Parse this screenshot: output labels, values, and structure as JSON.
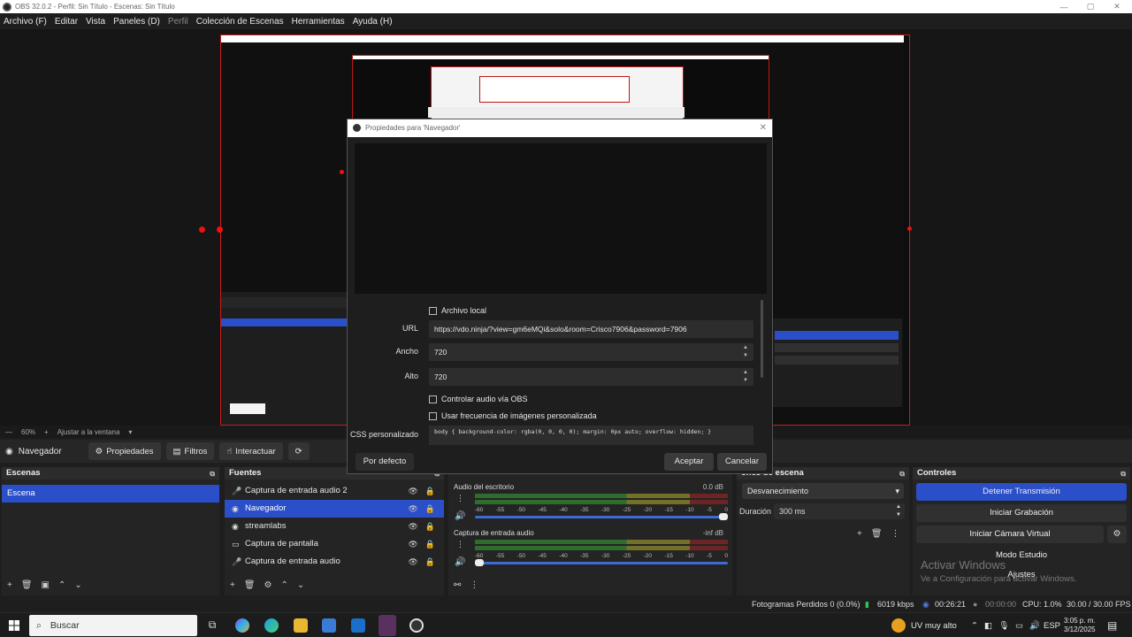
{
  "window": {
    "title": "OBS 32.0.2 - Perfil: Sin Título - Escenas: Sin Título"
  },
  "menu": [
    "Archivo (F)",
    "Editar",
    "Vista",
    "Paneles (D)",
    "Perfil",
    "Colección de Escenas",
    "Herramientas",
    "Ayuda (H)"
  ],
  "zoom": {
    "value": "60%",
    "fit": "Ajustar a la ventana"
  },
  "source_toolbar": {
    "source": "Navegador",
    "properties": "Propiedades",
    "filters": "Filtros",
    "interact": "Interactuar"
  },
  "scenes": {
    "title": "Escenas",
    "items": [
      "Escena"
    ]
  },
  "sources": {
    "title": "Fuentes",
    "items": [
      "Captura de entrada audio 2",
      "Navegador",
      "streamlabs",
      "Captura de pantalla",
      "Captura de entrada audio"
    ]
  },
  "mixer": {
    "tracks": [
      {
        "name": "Audio del escritorio",
        "db": "0.0 dB"
      },
      {
        "name": "Captura de entrada audio",
        "db": "-inf dB"
      }
    ],
    "ticks": [
      "-60",
      "-55",
      "-50",
      "-45",
      "-40",
      "-35",
      "-30",
      "-25",
      "-20",
      "-15",
      "-10",
      "-5",
      "0"
    ]
  },
  "transitions": {
    "title": "ones de escena",
    "type": "Desvanecimiento",
    "duration_label": "Duración",
    "duration_value": "300 ms"
  },
  "controls": {
    "title": "Controles",
    "stop_stream": "Detener Transmisión",
    "start_record": "Iniciar Grabación",
    "virtual_cam": "Iniciar Cámara Virtual",
    "studio": "Modo Estudio",
    "settings": "Ajustes"
  },
  "status": {
    "dropped": "Fotogramas Perdidos 0 (0.0%)",
    "kbps": "6019 kbps",
    "live_time": "00:26:21",
    "rec_time": "00:00:00",
    "cpu": "CPU: 1.0%",
    "fps": "30.00 / 30.00 FPS"
  },
  "activate": {
    "title": "Activar Windows",
    "sub": "Ve a Configuración para activar Windows."
  },
  "dialog": {
    "title": "Propiedades para 'Navegador'",
    "local_file": "Archivo local",
    "url_label": "URL",
    "url_value": "https://vdo.ninja/?view=gm6eMQi&solo&room=Crisco7906&password=7906",
    "width_label": "Ancho",
    "width_value": "720",
    "height_label": "Alto",
    "height_value": "720",
    "audio_obs": "Controlar audio vía OBS",
    "custom_fps": "Usar frecuencia de imágenes personalizada",
    "css_label": "CSS personalizado",
    "css_value": "body { background-color: rgba(0, 0, 0, 0); margin: 0px auto; overflow: hidden; }",
    "defaults": "Por defecto",
    "ok": "Aceptar",
    "cancel": "Cancelar"
  },
  "taskbar": {
    "search": "Buscar",
    "weather": "UV muy alto",
    "lang": "ESP",
    "time": "3:05 p. m.",
    "date": "3/12/2025"
  },
  "colors": {
    "accent": "#2a4fc9",
    "selection_red": "#d01a1a"
  }
}
